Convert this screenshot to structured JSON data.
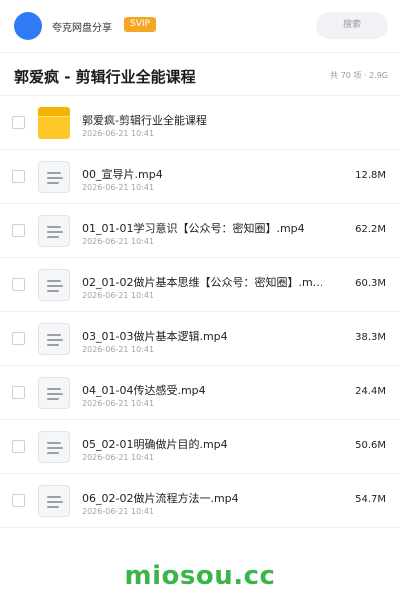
{
  "header": {
    "username": "夸克网盘分享",
    "vip_badge": "SVIP",
    "search_placeholder": "搜索"
  },
  "share": {
    "title": "郭爱疯 - 剪辑行业全能课程",
    "meta": "共 70 项 · 2.9G"
  },
  "files": [
    {
      "name": "郭爱疯-剪辑行业全能课程",
      "date": "2026-06-21 10:41",
      "size": "",
      "type": "folder"
    },
    {
      "name": "00_宣导片.mp4",
      "date": "2026-06-21 10:41",
      "size": "12.8M",
      "type": "video"
    },
    {
      "name": "01_01-01学习意识【公众号：密知圈】.mp4",
      "date": "2026-06-21 10:41",
      "size": "62.2M",
      "type": "video"
    },
    {
      "name": "02_01-02做片基本思维【公众号：密知圈】.m…",
      "date": "2026-06-21 10:41",
      "size": "60.3M",
      "type": "video"
    },
    {
      "name": "03_01-03做片基本逻辑.mp4",
      "date": "2026-06-21 10:41",
      "size": "38.3M",
      "type": "video"
    },
    {
      "name": "04_01-04传达感受.mp4",
      "date": "2026-06-21 10:41",
      "size": "24.4M",
      "type": "video"
    },
    {
      "name": "05_02-01明确做片目的.mp4",
      "date": "2026-06-21 10:41",
      "size": "50.6M",
      "type": "video"
    },
    {
      "name": "06_02-02做片流程方法一.mp4",
      "date": "2026-06-21 10:41",
      "size": "54.7M",
      "type": "video"
    }
  ],
  "watermark": "miosou.cc",
  "colors": {
    "avatar": "#2f7bf6",
    "vip": "#f5a623",
    "folder": "#fdc828",
    "watermark": "#3ab54a"
  }
}
